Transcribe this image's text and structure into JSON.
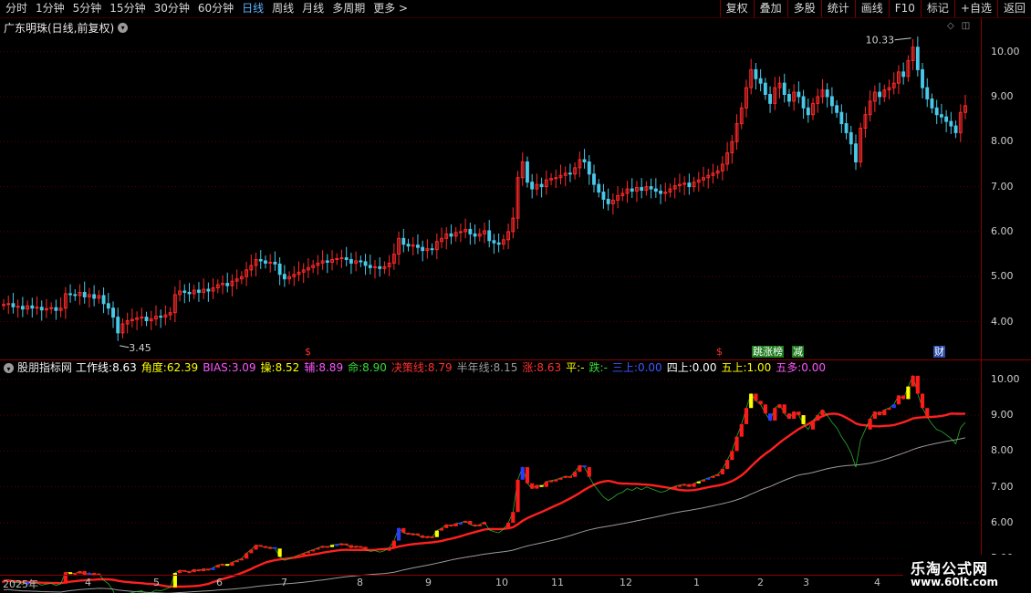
{
  "toolbar": {
    "periods": [
      "分时",
      "1分钟",
      "5分钟",
      "15分钟",
      "30分钟",
      "60分钟",
      "日线",
      "周线",
      "月线",
      "多周期",
      "更多 >"
    ],
    "active_period": "日线",
    "actions": [
      "复权",
      "叠加",
      "多股",
      "统计",
      "画线",
      "F10",
      "标记",
      "+自选",
      "返回"
    ]
  },
  "price_panel": {
    "title": "广东明珠(日线,前复权)",
    "high_label": "10.33",
    "low_label": "3.45",
    "axis_labels": [
      "10.00",
      "9.00",
      "8.00",
      "7.00",
      "6.00",
      "5.00",
      "4.00"
    ],
    "markers": [
      {
        "text": "$",
        "color": "#ff3030"
      },
      {
        "text": "$",
        "color": "#ff3030"
      },
      {
        "text": "跳涨榜",
        "color": "#ffffff",
        "bg": "#1c7a1c"
      },
      {
        "text": "减",
        "color": "#ffffff",
        "bg": "#1c7a1c"
      },
      {
        "text": "财",
        "color": "#ffffff",
        "bg": "#2a4aa8"
      }
    ]
  },
  "indicator_panel": {
    "name": "股朋指标网",
    "fields": [
      {
        "label": "工作线:",
        "value": "8.63",
        "color": "#ffffff"
      },
      {
        "label": "角度:",
        "value": "62.39",
        "color": "#ffff00"
      },
      {
        "label": "BIAS:",
        "value": "3.09",
        "color": "#ff55ff"
      },
      {
        "label": "操:",
        "value": "8.52",
        "color": "#ffff00"
      },
      {
        "label": "辅:",
        "value": "8.89",
        "color": "#ff55ff"
      },
      {
        "label": "命:",
        "value": "8.90",
        "color": "#33dd33"
      },
      {
        "label": "决策线:",
        "value": "8.79",
        "color": "#ff3030"
      },
      {
        "label": "半年线:",
        "value": "8.15",
        "color": "#9a9a9a"
      },
      {
        "label": "涨:",
        "value": "8.63",
        "color": "#ff3030"
      },
      {
        "label": "平:",
        "value": "-",
        "color": "#ffff00"
      },
      {
        "label": "跌:",
        "value": "-",
        "color": "#33dd33"
      },
      {
        "label": "三上:",
        "value": "0.00",
        "color": "#3a5aff"
      },
      {
        "label": "四上:",
        "value": "0.00",
        "color": "#ffffff"
      },
      {
        "label": "五上:",
        "value": "1.00",
        "color": "#ffff00"
      },
      {
        "label": "五多:",
        "value": "0.00",
        "color": "#ff55ff"
      }
    ],
    "axis_labels": [
      "10.00",
      "9.00",
      "8.00",
      "7.00",
      "6.00",
      "5.00"
    ]
  },
  "date_axis": {
    "labels": [
      "2025年",
      "4",
      "5",
      "6",
      "7",
      "8",
      "9",
      "10",
      "11",
      "12",
      "1",
      "2",
      "3",
      "4"
    ]
  },
  "watermark": {
    "line1": "乐淘公式网",
    "line2": "www.60lt.com"
  },
  "chart_data": {
    "type": "candlestick",
    "series": [
      {
        "values": [
          4.38,
          4.4,
          4.33,
          4.34,
          4.28,
          4.35,
          4.3,
          4.32,
          4.26,
          4.29,
          4.31,
          4.25,
          4.3,
          4.62,
          4.6,
          4.58,
          4.65,
          4.55,
          4.6,
          4.52,
          4.58,
          4.4,
          4.3,
          4.1,
          3.75,
          3.95,
          4.02,
          4.05,
          4.08,
          4.1,
          4.02,
          4.06,
          4.12,
          4.1,
          4.15,
          4.2,
          4.6,
          4.68,
          4.65,
          4.62,
          4.7,
          4.65,
          4.72,
          4.68,
          4.75,
          4.82,
          4.85,
          4.8,
          4.9,
          4.95,
          5.0,
          5.15,
          5.25,
          5.38,
          5.35,
          5.3,
          5.32,
          5.28,
          5.05,
          4.95,
          5.0,
          5.05,
          5.1,
          5.15,
          5.2,
          5.25,
          5.3,
          5.35,
          5.32,
          5.38,
          5.4,
          5.42,
          5.38,
          5.3,
          5.35,
          5.33,
          5.25,
          5.2,
          5.22,
          5.18,
          5.22,
          5.3,
          5.5,
          5.85,
          5.72,
          5.68,
          5.7,
          5.65,
          5.58,
          5.62,
          5.6,
          5.78,
          5.85,
          5.95,
          5.9,
          5.98,
          6.0,
          6.05,
          5.95,
          5.9,
          5.95,
          6.02,
          5.8,
          5.75,
          5.72,
          5.82,
          6.0,
          6.3,
          7.2,
          7.55,
          7.1,
          6.95,
          7.05,
          7.0,
          7.15,
          7.18,
          7.2,
          7.25,
          7.3,
          7.28,
          7.42,
          7.6,
          7.55,
          7.28,
          7.05,
          6.88,
          6.72,
          6.62,
          6.7,
          6.8,
          6.85,
          6.95,
          6.9,
          6.98,
          6.92,
          7.0,
          6.95,
          6.9,
          6.85,
          6.88,
          6.95,
          7.02,
          7.05,
          7.08,
          7.0,
          7.1,
          7.15,
          7.2,
          7.25,
          7.3,
          7.35,
          7.5,
          7.75,
          8.0,
          8.4,
          8.75,
          9.2,
          9.6,
          9.4,
          9.3,
          9.05,
          8.85,
          9.2,
          9.3,
          9.05,
          8.9,
          9.1,
          9.0,
          8.75,
          8.6,
          8.85,
          9.0,
          9.15,
          9.0,
          8.8,
          8.65,
          8.4,
          8.2,
          7.95,
          7.55,
          8.3,
          8.6,
          8.9,
          9.1,
          9.0,
          9.15,
          9.2,
          9.3,
          9.55,
          9.45,
          9.8,
          10.1,
          9.6,
          9.2,
          8.95,
          8.75,
          8.6,
          8.55,
          8.45,
          8.35,
          8.2,
          8.65,
          8.8
        ]
      }
    ],
    "y_range": [
      3.2,
      10.5
    ],
    "indicator_y_range": [
      4.6,
      10.3
    ],
    "lines": [
      {
        "name": "决策线",
        "color": "#ff2020"
      },
      {
        "name": "半年线",
        "color": "#9a9a9a"
      }
    ]
  }
}
